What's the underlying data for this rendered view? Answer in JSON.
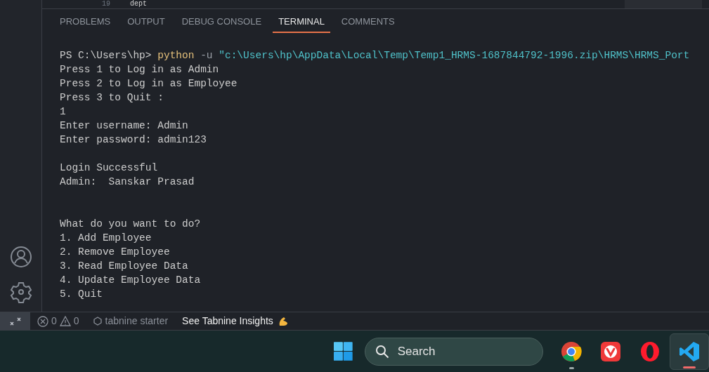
{
  "editor": {
    "line_number": "19",
    "code": "dept"
  },
  "panel_tabs": [
    {
      "label": "PROBLEMS",
      "selected": false
    },
    {
      "label": "OUTPUT",
      "selected": false
    },
    {
      "label": "DEBUG CONSOLE",
      "selected": false
    },
    {
      "label": "TERMINAL",
      "selected": true
    },
    {
      "label": "COMMENTS",
      "selected": false
    }
  ],
  "terminal": {
    "lines": [
      {
        "segments": [
          {
            "kind": "plain",
            "text": "PS C:\\Users\\hp> "
          },
          {
            "kind": "command",
            "text": "python"
          },
          {
            "kind": "flag",
            "text": " -u "
          },
          {
            "kind": "string",
            "text": "\"c:\\Users\\hp\\AppData\\Local\\Temp\\Temp1_HRMS-1687844792-1996.zip\\HRMS\\HRMS_Port"
          }
        ]
      },
      {
        "segments": [
          {
            "kind": "plain",
            "text": "Press 1 to Log in as Admin"
          }
        ]
      },
      {
        "segments": [
          {
            "kind": "plain",
            "text": "Press 2 to Log in as Employee"
          }
        ]
      },
      {
        "segments": [
          {
            "kind": "plain",
            "text": "Press 3 to Quit :"
          }
        ]
      },
      {
        "segments": [
          {
            "kind": "plain",
            "text": "1"
          }
        ]
      },
      {
        "segments": [
          {
            "kind": "plain",
            "text": "Enter username: Admin"
          }
        ]
      },
      {
        "segments": [
          {
            "kind": "plain",
            "text": "Enter password: admin123"
          }
        ]
      },
      {
        "kind": "spaced",
        "segments": [
          {
            "kind": "plain",
            "text": "Login Successful"
          }
        ]
      },
      {
        "segments": [
          {
            "kind": "plain",
            "text": "Admin:  Sanskar Prasad"
          }
        ]
      },
      {
        "kind": "widespaced",
        "segments": [
          {
            "kind": "plain",
            "text": "What do you want to do?"
          }
        ]
      },
      {
        "segments": [
          {
            "kind": "plain",
            "text": "1. Add Employee"
          }
        ]
      },
      {
        "segments": [
          {
            "kind": "plain",
            "text": "2. Remove Employee"
          }
        ]
      },
      {
        "segments": [
          {
            "kind": "plain",
            "text": "3. Read Employee Data"
          }
        ]
      },
      {
        "segments": [
          {
            "kind": "plain",
            "text": "4. Update Employee Data"
          }
        ]
      },
      {
        "segments": [
          {
            "kind": "plain",
            "text": "5. Quit"
          }
        ]
      }
    ]
  },
  "status_bar": {
    "errors": "0",
    "warnings": "0",
    "extension": "tabnine starter",
    "insights": "See Tabnine Insights"
  },
  "taskbar": {
    "search_placeholder": "Search",
    "apps": [
      {
        "kind": "chrome",
        "running": true,
        "active": false
      },
      {
        "kind": "vivaldi",
        "running": false,
        "active": false
      },
      {
        "kind": "opera",
        "running": false,
        "active": false
      },
      {
        "kind": "vscode",
        "running": true,
        "active": true
      }
    ]
  }
}
